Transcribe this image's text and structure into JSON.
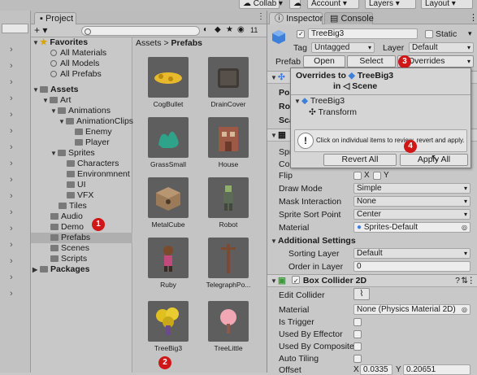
{
  "toolbar": {
    "collab": "Collab",
    "account": "Account",
    "layers": "Layers",
    "layout": "Layout"
  },
  "project": {
    "tab_label": "Project",
    "tab_count": "11",
    "breadcrumb": {
      "root": "Assets",
      "sep": ">",
      "current": "Prefabs"
    },
    "tree": {
      "favorites": "Favorites",
      "fav_items": [
        "All Materials",
        "All Models",
        "All Prefabs"
      ],
      "assets": "Assets",
      "art": "Art",
      "animations": "Animations",
      "animation_clips": "AnimationClips",
      "enemy": "Enemy",
      "player": "Player",
      "sprites": "Sprites",
      "characters": "Characters",
      "environment": "Environmnent",
      "ui": "UI",
      "vfx": "VFX",
      "tiles": "Tiles",
      "audio": "Audio",
      "demo": "Demo",
      "prefabs": "Prefabs",
      "scenes": "Scenes",
      "scripts": "Scripts",
      "packages": "Packages"
    },
    "assets": [
      "CogBullet",
      "DrainCover",
      "GrassSmall",
      "House",
      "MetalCube",
      "Robot",
      "Ruby",
      "TelegraphPo...",
      "TreeBig3",
      "TreeLittle"
    ]
  },
  "inspector": {
    "tab_label": "Inspector",
    "console_label": "Console",
    "object_name": "TreeBig3",
    "static_label": "Static",
    "tag_label": "Tag",
    "tag_value": "Untagged",
    "layer_label": "Layer",
    "layer_value": "Default",
    "prefab_label": "Prefab",
    "open_label": "Open",
    "select_label": "Select",
    "overrides_label": "Overrides",
    "partial_labels": [
      "Posi",
      "Rot",
      "Scal",
      "Sprit",
      "Colo"
    ],
    "flip_label": "Flip",
    "flip_x": "X",
    "flip_y": "Y",
    "draw_mode_label": "Draw Mode",
    "draw_mode_value": "Simple",
    "mask_label": "Mask Interaction",
    "mask_value": "None",
    "sort_point_label": "Sprite Sort Point",
    "sort_point_value": "Center",
    "material_label": "Material",
    "material_value": "Sprites-Default",
    "additional_label": "Additional Settings",
    "sorting_layer_label": "Sorting Layer",
    "sorting_layer_value": "Default",
    "order_label": "Order in Layer",
    "order_value": "0",
    "box_collider_label": "Box Collider 2D",
    "edit_collider_label": "Edit Collider",
    "bc_material_label": "Material",
    "bc_material_value": "None (Physics Material 2D)",
    "is_trigger_label": "Is Trigger",
    "used_by_effector_label": "Used By Effector",
    "used_by_composite_label": "Used By Composite",
    "auto_tiling_label": "Auto Tiling",
    "offset_label": "Offset",
    "offset_x_label": "X",
    "offset_x_value": "0.0335",
    "offset_y_label": "Y",
    "offset_y_value": "0.20651"
  },
  "popup": {
    "title_prefix": "Overrides to",
    "title_object": "TreeBig3",
    "title_in": "in",
    "title_scene": "Scene",
    "tree_root": "TreeBig3",
    "tree_child": "Transform",
    "info_text": "Click on individual items to review, revert and apply.",
    "revert_all": "Revert All",
    "apply_all": "Apply All"
  },
  "markers": [
    "1",
    "2",
    "3",
    "4"
  ],
  "colors": {
    "selection": "#3a72d6",
    "marker": "#d01717",
    "cube_blue": "#3d7fd9"
  }
}
